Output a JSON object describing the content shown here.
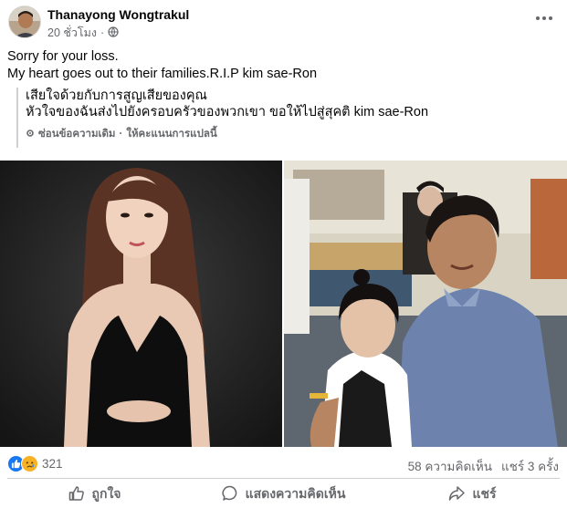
{
  "post": {
    "author": "Thanayong Wongtrakul",
    "time": "20 ชั่วโมง",
    "audience_icon": "globe-icon",
    "more_icon": "more-options-icon",
    "text_lines": [
      "Sorry for your loss.",
      "My heart goes out to their families.R.I.P kim sae-Ron"
    ],
    "translation": {
      "lines": [
        "เสียใจด้วยกับการสูญเสียของคุณ",
        "หัวใจของฉันส่งไปยังครอบครัวของพวกเขา ขอให้ไปสู่สุคติ kim sae-Ron"
      ],
      "hide_original": "ซ่อนข้อความเดิม",
      "separator": "·",
      "rate_translation": "ให้คะแนนการแปลนี้"
    }
  },
  "stats": {
    "reaction_icons": [
      "like-icon",
      "sad-icon"
    ],
    "reaction_count": "321",
    "comments": "58 ความคิดเห็น",
    "shares": "แชร์ 3 ครั้ง"
  },
  "actions": {
    "like": "ถูกใจ",
    "comment": "แสดงความคิดเห็น",
    "share": "แชร์"
  },
  "colors": {
    "like_blue": "#1877f2",
    "sad_yellow": "#f7b125",
    "secondary_text": "#65676b",
    "divider": "#ced0d4"
  }
}
